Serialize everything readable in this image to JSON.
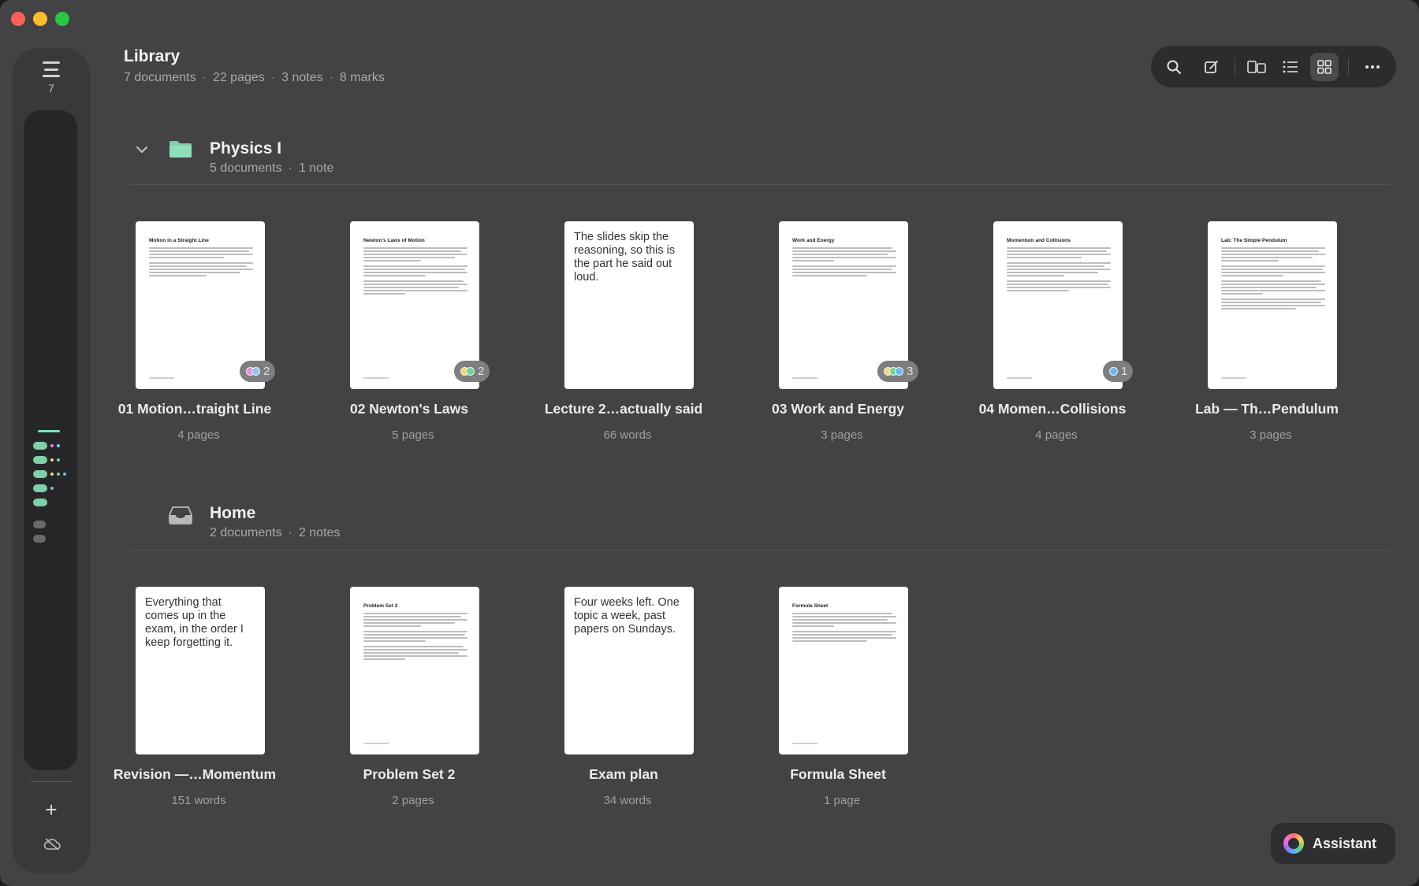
{
  "library": {
    "title": "Library",
    "stats": {
      "documents": "7 documents",
      "pages": "22 pages",
      "notes": "3 notes",
      "marks": "8 marks"
    }
  },
  "sidebar": {
    "count": "7"
  },
  "toolbar": {
    "icons": [
      "search-icon",
      "compose-icon",
      "layout-icon",
      "list-view-icon",
      "grid-view-icon",
      "more-icon"
    ],
    "active": "grid-view-icon"
  },
  "sections": [
    {
      "title": "Physics I",
      "meta_documents": "5 documents",
      "meta_notes": "1 note",
      "icon": "folder-icon",
      "items": [
        {
          "title": "01 Motion…traight Line",
          "meta": "4 pages",
          "type": "doc",
          "page_title": "Motion in a Straight Line",
          "marks": "2",
          "mark_colors": [
            "#f08ad6",
            "#8ac8f0"
          ]
        },
        {
          "title": "02 Newton's Laws",
          "meta": "5 pages",
          "type": "doc",
          "page_title": "Newton's Laws of Motion",
          "marks": "2",
          "mark_colors": [
            "#f5d76e",
            "#6fd39a"
          ]
        },
        {
          "title": "Lecture 2…actually said",
          "meta": "66 words",
          "type": "note",
          "note_text": "The slides skip the reasoning, so this is the part he said out loud."
        },
        {
          "title": "03 Work and Energy",
          "meta": "3 pages",
          "type": "doc",
          "page_title": "Work and Energy",
          "marks": "3",
          "mark_colors": [
            "#f5d76e",
            "#6fd39a",
            "#6fb6f5"
          ]
        },
        {
          "title": "04 Momen…Collisions",
          "meta": "4 pages",
          "type": "doc",
          "page_title": "Momentum and Collisions",
          "marks": "1",
          "mark_colors": [
            "#6fb6f5"
          ]
        },
        {
          "title": "Lab — Th…Pendulum",
          "meta": "3 pages",
          "type": "doc",
          "page_title": "Lab: The Simple Pendulum"
        }
      ]
    },
    {
      "title": "Home",
      "meta_documents": "2 documents",
      "meta_notes": "2 notes",
      "icon": "inbox-icon",
      "items": [
        {
          "title": "Revision —…Momentum",
          "meta": "151 words",
          "type": "note",
          "note_text": "Everything that comes up in the exam, in the order I keep forgetting it."
        },
        {
          "title": "Problem Set 2",
          "meta": "2 pages",
          "type": "doc",
          "page_title": "Problem Set 2"
        },
        {
          "title": "Exam plan",
          "meta": "34 words",
          "type": "note",
          "note_text": "Four weeks left. One topic a week, past papers on Sundays."
        },
        {
          "title": "Formula Sheet",
          "meta": "1 page",
          "type": "doc",
          "page_title": "Formula Sheet"
        }
      ]
    }
  ],
  "assistant": {
    "label": "Assistant"
  },
  "colors": {
    "accent": "#7be3c4",
    "window": "#434345",
    "folder": "#7fcfa8"
  }
}
